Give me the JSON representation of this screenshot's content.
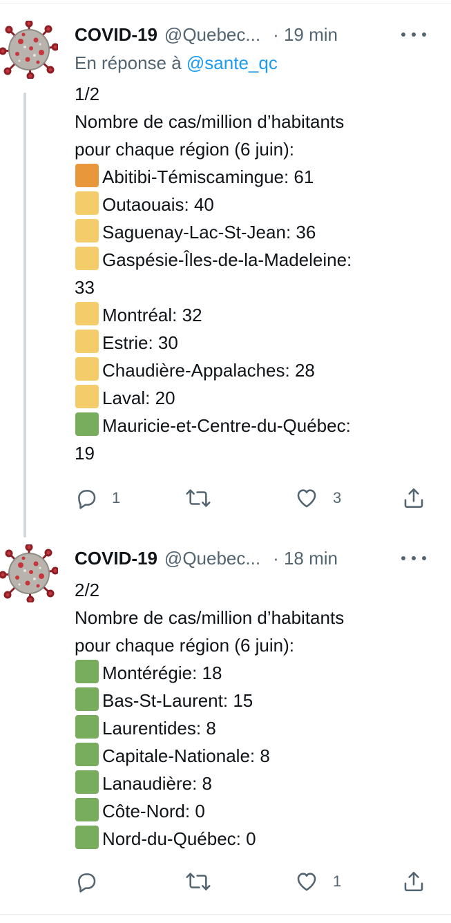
{
  "tweets": [
    {
      "author_name": "COVID-19",
      "author_handle": "@Quebec...",
      "time": "· 19 min",
      "reply_prefix": "En réponse à",
      "reply_handle": "@sante_qc",
      "part": "1/2",
      "intro_line1": "Nombre de cas/million d’habitants",
      "intro_line2": "pour chaque région (6 juin):",
      "regions": [
        {
          "text": "Abitibi-Témiscamingue: 61",
          "color": "#e8973b"
        },
        {
          "text": "Outaouais: 40",
          "color": "#f4cd6a"
        },
        {
          "text": "Saguenay-Lac-St-Jean: 36",
          "color": "#f4cd6a"
        },
        {
          "text": "Gaspésie-Îles-de-la-Madeleine:",
          "cont": "33",
          "color": "#f4cd6a"
        },
        {
          "text": "Montréal: 32",
          "color": "#f4cd6a"
        },
        {
          "text": "Estrie: 30",
          "color": "#f4cd6a"
        },
        {
          "text": "Chaudière-Appalaches: 28",
          "color": "#f4cd6a"
        },
        {
          "text": "Laval: 20",
          "color": "#f4cd6a"
        },
        {
          "text": "Mauricie-et-Centre-du-Québec:",
          "cont": "19",
          "color": "#78ad5e"
        }
      ],
      "reply_count": "1",
      "retweet_count": "",
      "like_count": "3"
    },
    {
      "author_name": "COVID-19",
      "author_handle": "@Quebec...",
      "time": "· 18 min",
      "part": "2/2",
      "intro_line1": "Nombre de cas/million d’habitants",
      "intro_line2": "pour chaque région (6 juin):",
      "regions": [
        {
          "text": "Montérégie: 18",
          "color": "#78ad5e"
        },
        {
          "text": "Bas-St-Laurent: 15",
          "color": "#78ad5e"
        },
        {
          "text": "Laurentides: 8",
          "color": "#78ad5e"
        },
        {
          "text": "Capitale-Nationale: 8",
          "color": "#78ad5e"
        },
        {
          "text": "Lanaudière: 8",
          "color": "#78ad5e"
        },
        {
          "text": "Côte-Nord: 0",
          "color": "#78ad5e"
        },
        {
          "text": "Nord-du-Québec: 0",
          "color": "#78ad5e"
        }
      ],
      "reply_count": "",
      "retweet_count": "",
      "like_count": "1"
    }
  ],
  "colors": {
    "text": "#0f1419",
    "muted": "#536471",
    "link": "#1d9bf0",
    "thread_line": "#cfd9de"
  },
  "icons": [
    "covid-virus-avatar-icon",
    "more-icon",
    "reply-icon",
    "retweet-icon",
    "like-icon",
    "share-icon"
  ]
}
